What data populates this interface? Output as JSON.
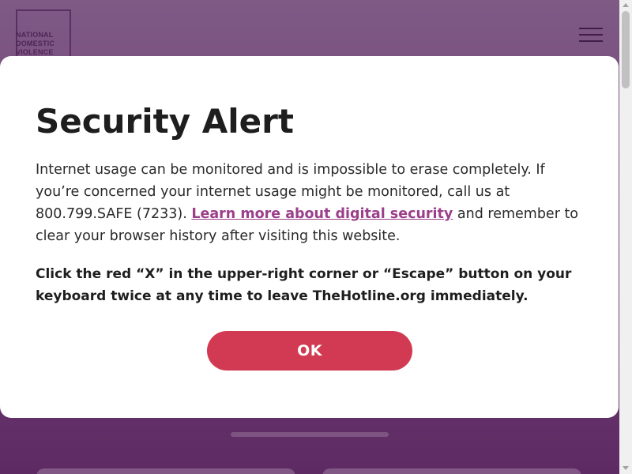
{
  "site": {
    "logo_lines": [
      "NATIONAL",
      "DOMESTIC",
      "VIOLENCE"
    ],
    "menu_icon": "hamburger-menu-icon"
  },
  "modal": {
    "title": "Security Alert",
    "body_part1": "Internet usage can be monitored and is impossible to erase completely. If you’re concerned your internet usage might be monitored, call us at 800.799.SAFE (7233). ",
    "link_text": "Learn more about digital security",
    "body_part2": " and remember to clear your browser history after visiting this website.",
    "warning": "Click the red “X” in the upper-right corner or “Escape” button on your keyboard twice at any time to leave TheHotline.org immediately.",
    "ok_label": "OK"
  },
  "colors": {
    "background": "#6f3f78",
    "link": "#9b3f8a",
    "ok_button": "#d13a52"
  }
}
